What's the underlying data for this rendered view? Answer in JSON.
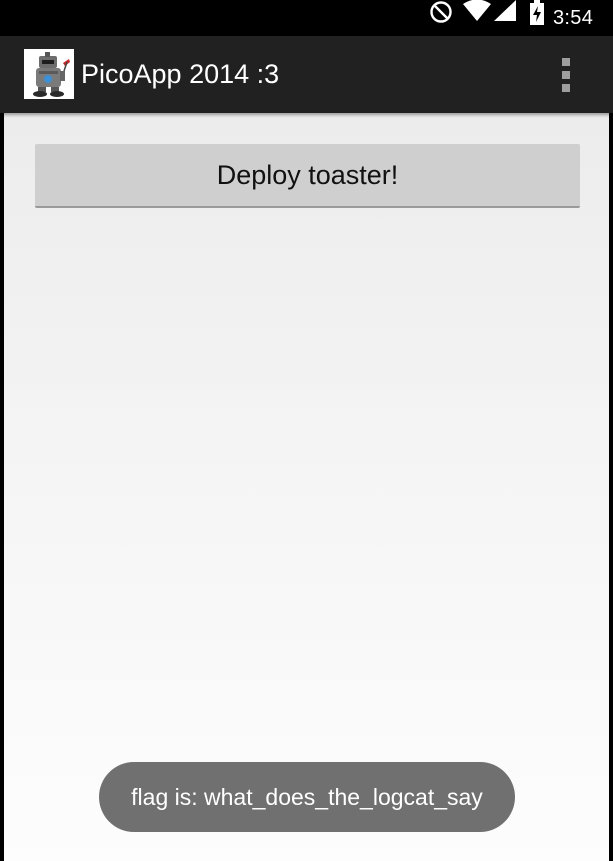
{
  "status_bar": {
    "time": "3:54",
    "icons": [
      "do-not-disturb-icon",
      "wifi-icon",
      "cell-signal-icon",
      "battery-charging-icon"
    ]
  },
  "action_bar": {
    "app_icon": "app-logo-icon",
    "title": "PicoApp 2014 :3",
    "overflow_icon": "overflow-menu-icon",
    "background": "#212121"
  },
  "main": {
    "deploy_button_label": "Deploy toaster!"
  },
  "toast": {
    "message": "flag is: what_does_the_logcat_say"
  },
  "colors": {
    "button": "#cfcfcf",
    "toast": "#707070",
    "content_background": "#efefef"
  }
}
